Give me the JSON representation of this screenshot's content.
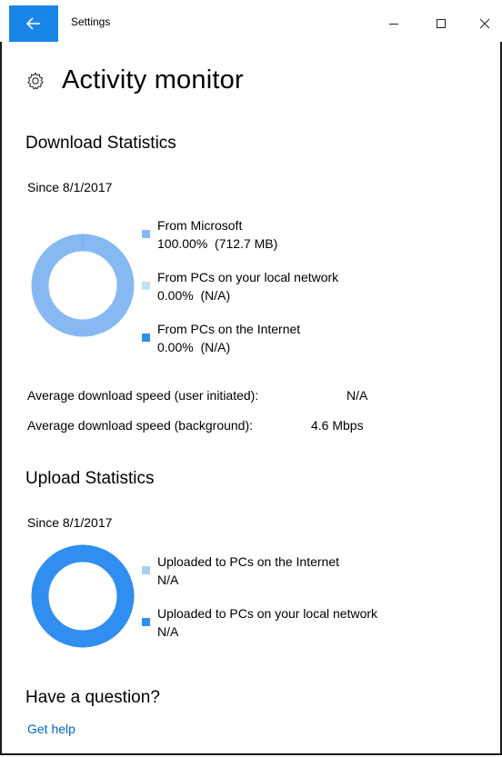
{
  "window": {
    "title": "Settings"
  },
  "page": {
    "title": "Activity monitor"
  },
  "download": {
    "heading": "Download Statistics",
    "since": "Since 8/1/2017",
    "legend": [
      {
        "label": "From Microsoft",
        "value": "100.00%  (712.7 MB)",
        "color": "#86b9f2"
      },
      {
        "label": "From PCs on your local network",
        "value": "0.00%  (N/A)",
        "color": "#c8def8"
      },
      {
        "label": "From PCs on the Internet",
        "value": "0.00%  (N/A)",
        "color": "#2f8ef0"
      }
    ],
    "stats": [
      {
        "label": "Average download speed (user initiated):",
        "value": "N/A"
      },
      {
        "label": "Average download speed (background):",
        "value": "4.6 Mbps"
      }
    ]
  },
  "upload": {
    "heading": "Upload Statistics",
    "since": "Since 8/1/2017",
    "legend": [
      {
        "label": "Uploaded to PCs on the Internet",
        "value": "N/A",
        "color": "#a9cff5"
      },
      {
        "label": "Uploaded to PCs on your local network",
        "value": "N/A",
        "color": "#2f8ef0"
      }
    ]
  },
  "help": {
    "heading": "Have a question?",
    "link": "Get help"
  },
  "colors": {
    "accent": "#1a85e8",
    "download_ring": "#86b9f2",
    "upload_ring": "#2f8ef0"
  }
}
